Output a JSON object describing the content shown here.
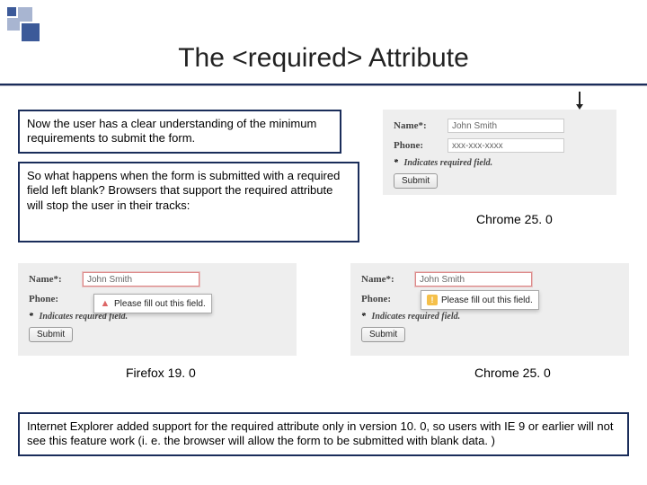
{
  "title": "The <required> Attribute",
  "callouts": {
    "c1": "Now the user has a clear understanding of the minimum requirements to submit the form.",
    "c2": "So what happens when the form is submitted with a required field left blank?  Browsers that support the required attribute will stop the user in their tracks:",
    "c3": "Internet Explorer added support for the required attribute only in version 10. 0, so users with IE 9 or earlier will not see this feature work (i. e. the browser will allow the form to be submitted with blank data. )"
  },
  "captions": {
    "a": "Chrome 25. 0",
    "b": "Firefox 19. 0",
    "c": "Chrome 25. 0"
  },
  "form": {
    "name_label": "Name*:",
    "phone_label": "Phone:",
    "name_placeholder": "John Smith",
    "phone_placeholder": "xxx-xxx-xxxx",
    "required_hint_a": "Indicates required field.",
    "required_hint_bc": "Indicates required field.",
    "asterisk": "*",
    "submit": "Submit",
    "msg_firefox": "Please fill out this field.",
    "msg_chrome": "Please fill out this field."
  }
}
